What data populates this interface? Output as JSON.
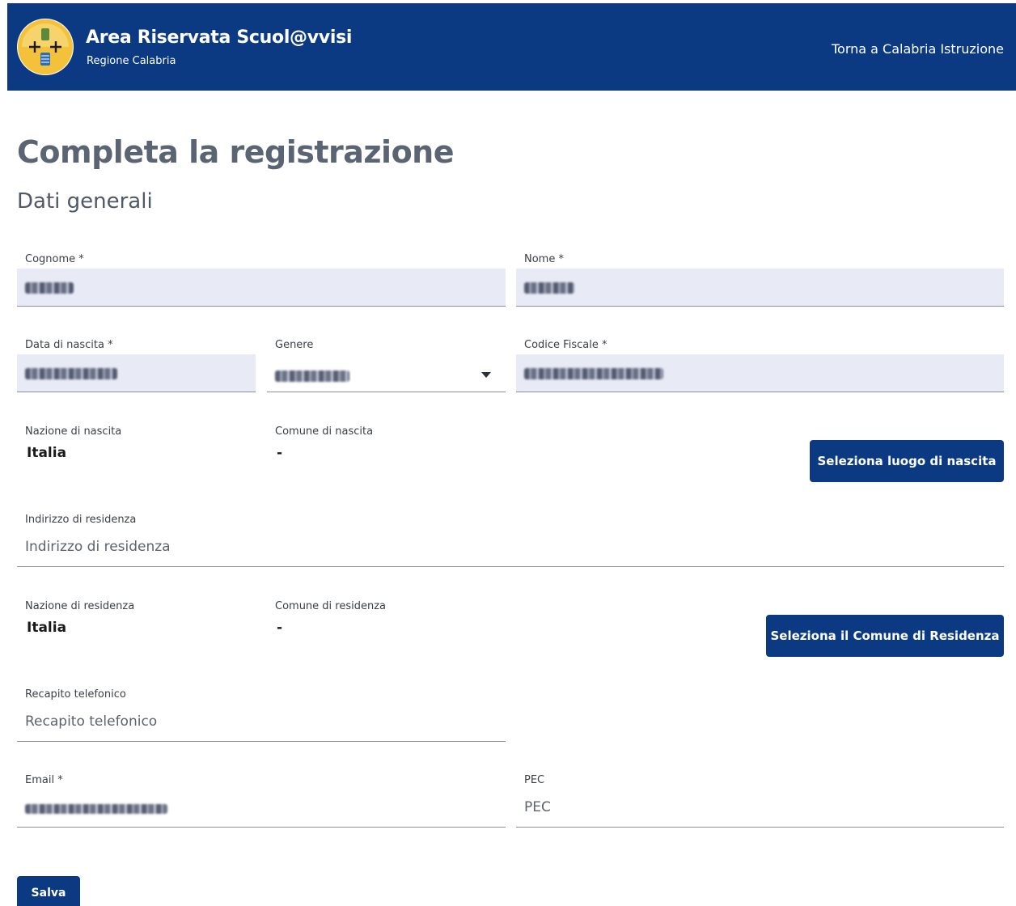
{
  "header": {
    "title": "Area Riservata Scuol@vvisi",
    "subtitle": "Regione Calabria",
    "back_link": "Torna a Calabria Istruzione",
    "logo_icon": "regione-calabria-crest-icon",
    "bg_color": "#0b3a82"
  },
  "page": {
    "title": "Completa la registrazione",
    "section": "Dati generali"
  },
  "form": {
    "cognome": {
      "label": "Cognome *"
    },
    "nome": {
      "label": "Nome *"
    },
    "data_nascita": {
      "label": "Data di nascita *"
    },
    "genere": {
      "label": "Genere"
    },
    "codice_fiscale": {
      "label": "Codice Fiscale *"
    },
    "nazione_nascita": {
      "label": "Nazione di nascita",
      "value": "Italia"
    },
    "comune_nascita": {
      "label": "Comune di nascita",
      "value": "-"
    },
    "seleziona_nascita": {
      "label": "Seleziona luogo di nascita"
    },
    "indirizzo": {
      "label": "Indirizzo di residenza",
      "placeholder": "Indirizzo di residenza"
    },
    "nazione_residenza": {
      "label": "Nazione di residenza",
      "value": "Italia"
    },
    "comune_residenza": {
      "label": "Comune di residenza",
      "value": "-"
    },
    "seleziona_residenza": {
      "label": "Seleziona il Comune di Residenza"
    },
    "telefono": {
      "label": "Recapito telefonico",
      "placeholder": "Recapito telefonico"
    },
    "email": {
      "label": "Email *"
    },
    "pec": {
      "label": "PEC",
      "placeholder": "PEC"
    },
    "salva": {
      "label": "Salva"
    }
  }
}
